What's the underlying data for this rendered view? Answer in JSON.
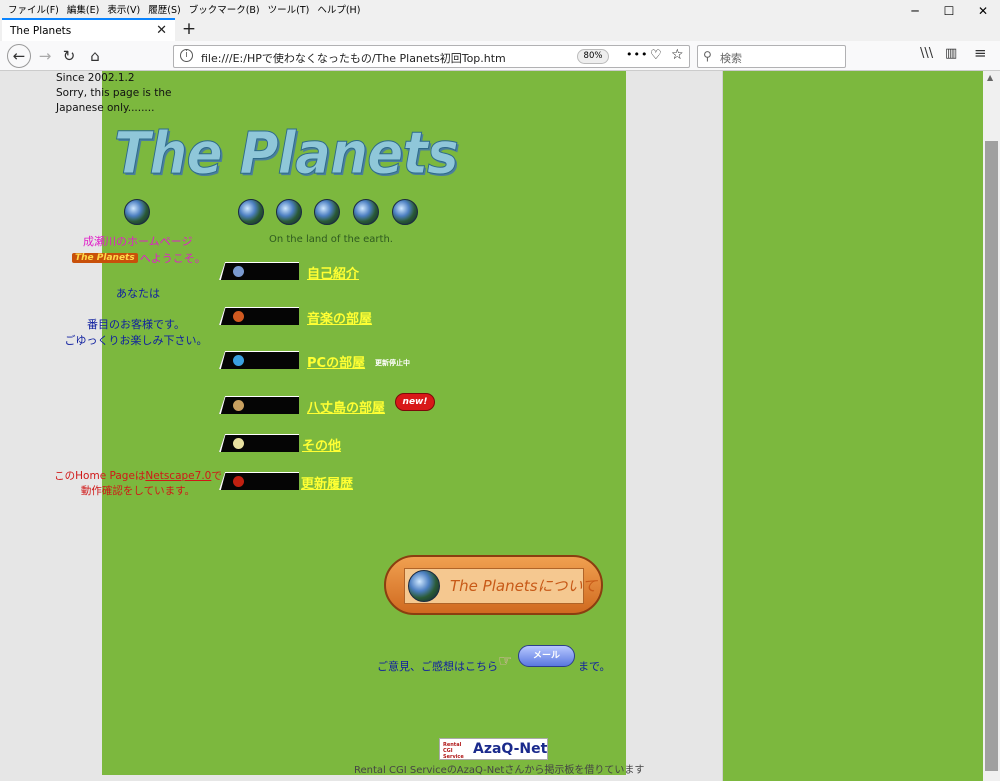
{
  "menubar": {
    "items": [
      "ファイル(F)",
      "編集(E)",
      "表示(V)",
      "履歴(S)",
      "ブックマーク(B)",
      "ツール(T)",
      "ヘルプ(H)"
    ]
  },
  "window": {
    "minimize": "─",
    "maximize": "☐",
    "close": "✕"
  },
  "tab": {
    "title": "The Planets",
    "close": "✕",
    "new_tab": "+"
  },
  "nav": {
    "back": "←",
    "forward": "→",
    "reload": "↻",
    "home": "⌂",
    "url": "file:///E:/HPで使わなくなったもの/The Planets初回Top.htm",
    "zoom": "80%",
    "more": "•••",
    "pocket": "♡",
    "star": "☆",
    "search_placeholder": "検索",
    "library": "\\\\\\",
    "sidebar": "▥",
    "menu": "≡"
  },
  "page": {
    "since": "Since 2002.1.2",
    "sorry": "Sorry, this page is the Japanese only........",
    "logo": "The Planets",
    "tagline": "On the land of the earth.",
    "welcome_line1": "成瀬川のホームページ",
    "welcome_badge": "The Planets",
    "welcome_line2": "へようこそ。",
    "anata": "あなたは",
    "visitor_line1": "番目のお客様です。",
    "visitor_line2": "ごゆっくりお楽しみ下さい。",
    "netscape_pre": "このHome Pageは",
    "netscape_link": "Netscape7.0",
    "netscape_post": "で",
    "netscape_line2": "動作確認をしています。",
    "menu": [
      {
        "label": "自己紹介",
        "planet": "#7a9ad0"
      },
      {
        "label": "音楽の部屋",
        "planet": "#d05a20"
      },
      {
        "label": "PCの部屋",
        "planet": "#3aa0e0",
        "note": "更新停止中"
      },
      {
        "label": "八丈島の部屋",
        "planet": "#c8a060",
        "badge": "new!"
      },
      {
        "label": "その他",
        "planet": "#e8e0a0"
      },
      {
        "label": "更新履歴",
        "planet": "#c02010"
      }
    ],
    "about_label": "The Planetsについて",
    "opinion": "ご意見、ご感想はこちら",
    "mail_label": "メール",
    "made": "まで。",
    "azaq_small": "Rental CGI Service",
    "azaq_logo": "AzaQ-Net",
    "rental": "Rental CGI ServiceのAzaQ-Netさんから掲示板を借りています"
  },
  "colors": {
    "green": "#7cb83e",
    "gray": "#e6e6e6",
    "link_yellow": "#ffff33",
    "magenta": "#e020c8",
    "blue_text": "#1020a0",
    "red_text": "#d01818"
  }
}
